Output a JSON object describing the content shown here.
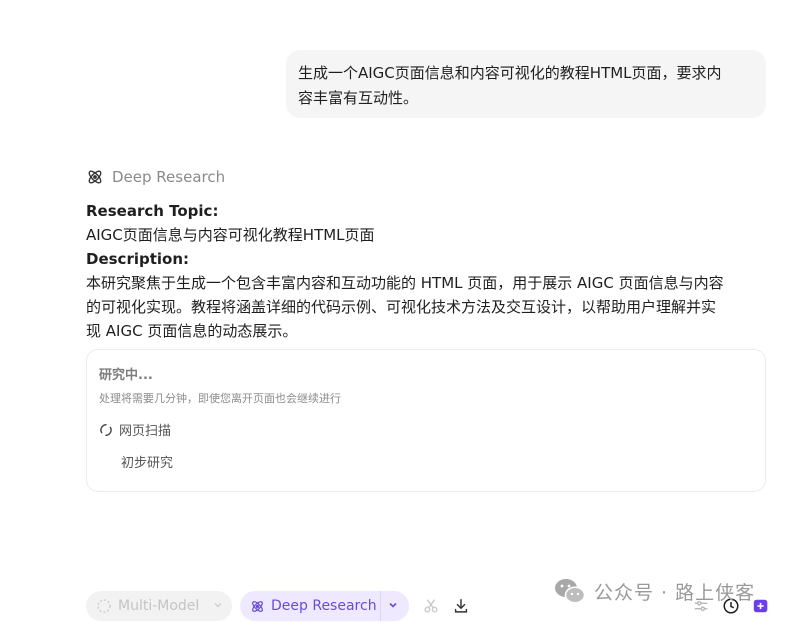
{
  "user_message": {
    "line1": "生成一个AIGC页面信息和内容可视化的教程HTML页面，要求内",
    "line2": "容丰富有互动性。"
  },
  "agent": {
    "name": "Deep Research",
    "icon": "atom-icon"
  },
  "response": {
    "topic_label": "Research Topic:",
    "topic": "AIGC页面信息与内容可视化教程HTML页面",
    "description_label": "Description:",
    "description_line1": "本研究聚焦于生成一个包含丰富内容和互动功能的 HTML 页面，用于展示 AIGC 页面信息与内容",
    "description_line2": "的可视化实现。教程将涵盖详细的代码示例、可视化技术方法及交互设计，以帮助用户理解并实",
    "description_line3": "现 AIGC 页面信息的动态展示。"
  },
  "research_card": {
    "status": "研究中...",
    "subtitle": "处理将需要几分钟，即使您离开页面也会继续进行",
    "steps": [
      "网页扫描",
      "初步研究"
    ]
  },
  "toolbar": {
    "multi_model_label": "Multi-Model",
    "deep_research_label": "Deep Research"
  },
  "watermark": {
    "text": "公众号 · 路上侠客"
  },
  "colors": {
    "accent": "#6a4bd6",
    "accent_bg": "#efe9ff",
    "muted": "#8a8a8a"
  }
}
